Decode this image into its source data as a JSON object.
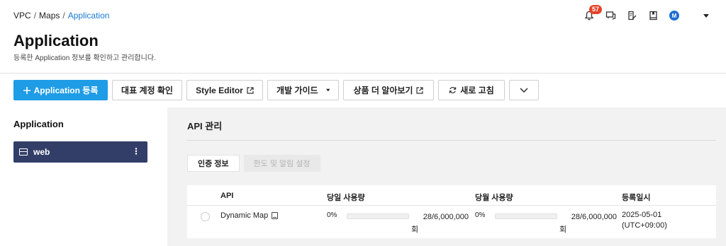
{
  "breadcrumb": {
    "items": [
      "VPC",
      "Maps"
    ],
    "separator": "/",
    "current": "Application"
  },
  "topbar": {
    "notification_count": "57",
    "avatar_initial": "M"
  },
  "header": {
    "title": "Application",
    "description": "등록한 Application 정보를 확인하고 관리합니다."
  },
  "toolbar": {
    "register_label": "Application 등록",
    "rep_account_label": "대표 계정 확인",
    "style_editor_label": "Style Editor",
    "dev_guide_label": "개발 가이드",
    "learn_more_label": "상품 더 알아보기",
    "refresh_label": "새로 고침"
  },
  "sidebar": {
    "title": "Application",
    "items": [
      {
        "label": "web"
      }
    ]
  },
  "main": {
    "section_title": "API 관리",
    "tabs": [
      {
        "label": "인증 정보",
        "active": true
      },
      {
        "label": "한도 및 알림 설정",
        "active": false
      }
    ],
    "table": {
      "columns": [
        "API",
        "당일 사용량",
        "당월 사용량",
        "등록일시"
      ],
      "rows": [
        {
          "api": "Dynamic Map",
          "daily_pct": "0%",
          "daily_fill": 0,
          "daily_count": "28/6,000,000",
          "daily_unit": "회",
          "monthly_pct": "0%",
          "monthly_fill": 0,
          "monthly_count": "28/6,000,000",
          "monthly_unit": "회",
          "reg_date": "2025-05-01",
          "reg_tz": "(UTC+09:00)"
        }
      ]
    }
  },
  "colors": {
    "primary": "#1f9ce6",
    "sidebar_active": "#333e68",
    "badge": "#e5432a",
    "breadcrumb_current": "#1a7ad4"
  }
}
